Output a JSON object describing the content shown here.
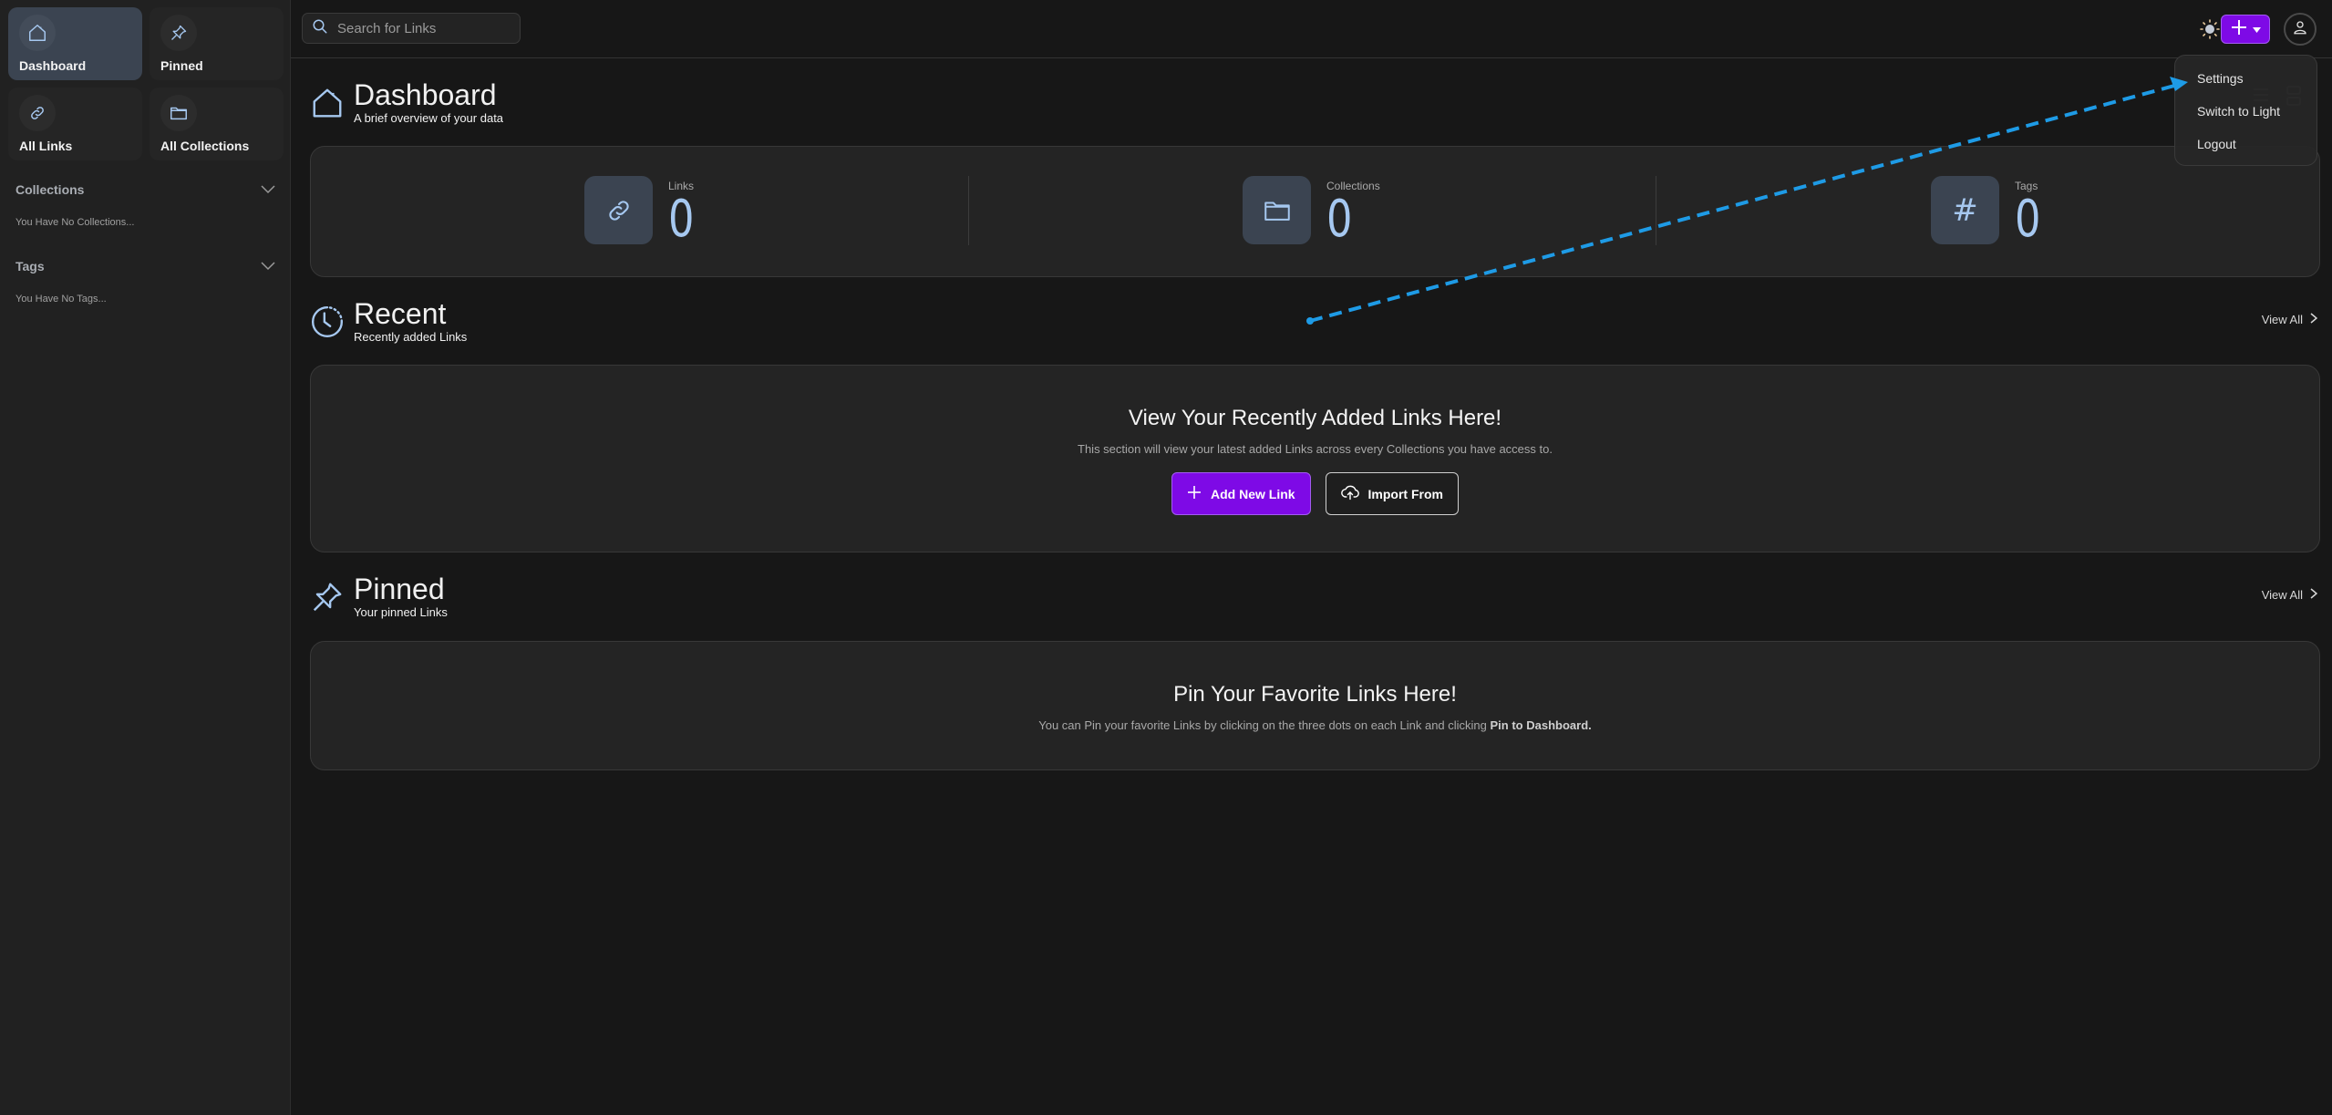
{
  "sidebar": {
    "nav": [
      {
        "label": "Dashboard",
        "icon": "home-icon",
        "active": true
      },
      {
        "label": "Pinned",
        "icon": "pin-icon",
        "active": false
      },
      {
        "label": "All Links",
        "icon": "link-icon",
        "active": false
      },
      {
        "label": "All Collections",
        "icon": "folder-icon",
        "active": false
      }
    ],
    "collections": {
      "title": "Collections",
      "empty": "You Have No Collections..."
    },
    "tags": {
      "title": "Tags",
      "empty": "You Have No Tags..."
    }
  },
  "header": {
    "search_placeholder": "Search for Links",
    "search_value": "",
    "theme_icon": "sun-icon",
    "add_icon": "plus-icon",
    "profile_icon": "user-icon"
  },
  "profile_menu": {
    "items": [
      "Settings",
      "Switch to Light",
      "Logout"
    ]
  },
  "dashboard": {
    "title": "Dashboard",
    "subtitle": "A brief overview of your data",
    "stats": [
      {
        "label": "Links",
        "value": "0",
        "icon": "link-icon"
      },
      {
        "label": "Collections",
        "value": "0",
        "icon": "folder-icon"
      },
      {
        "label": "Tags",
        "value": "0",
        "icon": "hash-icon"
      }
    ]
  },
  "recent": {
    "title": "Recent",
    "subtitle": "Recently added Links",
    "view_all": "View All",
    "empty_title": "View Your Recently Added Links Here!",
    "empty_desc": "This section will view your latest added Links across every Collections you have access to.",
    "add_button": "Add New Link",
    "import_button": "Import From"
  },
  "pinned": {
    "title": "Pinned",
    "subtitle": "Your pinned Links",
    "view_all": "View All",
    "empty_title": "Pin Your Favorite Links Here!",
    "empty_desc_prefix": "You can Pin your favorite Links by clicking on the three dots on each Link and clicking ",
    "empty_desc_bold": "Pin to Dashboard."
  },
  "colors": {
    "accent": "#7e0ae6",
    "icon_blue": "#a6c8f0",
    "annotation_arrow": "#1e9be6"
  }
}
